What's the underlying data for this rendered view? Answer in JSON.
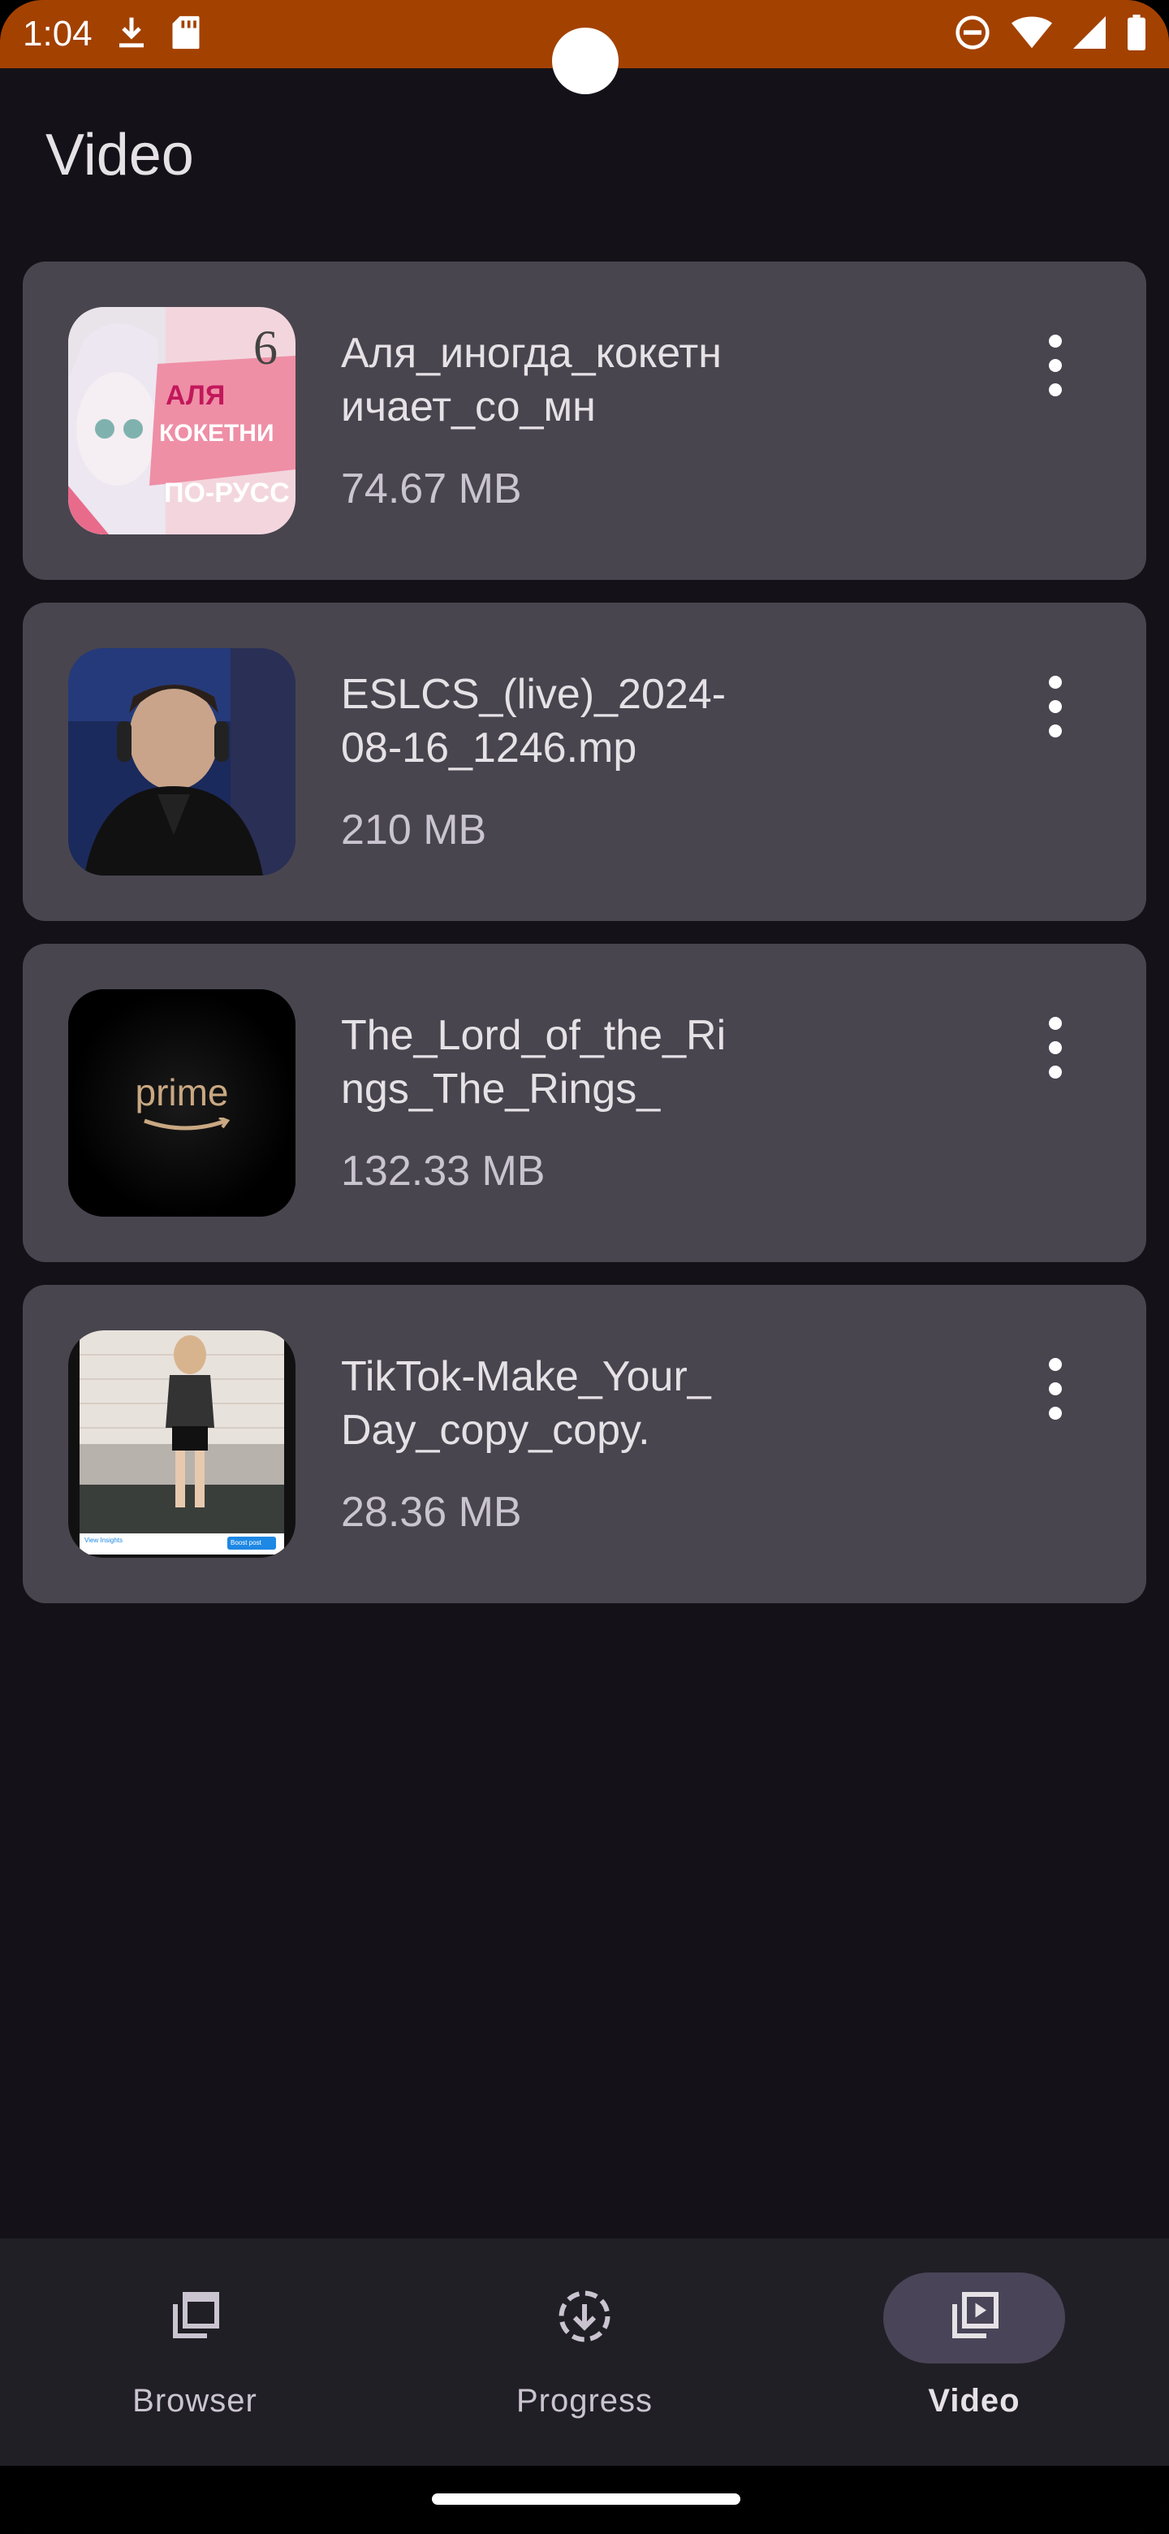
{
  "status_bar": {
    "time": "1:04",
    "left_icons": [
      "download-icon",
      "sd-card-icon"
    ],
    "right_icons": [
      "do-not-disturb-icon",
      "wifi-icon",
      "cellular-signal-icon",
      "battery-icon"
    ],
    "background": "#A34100"
  },
  "header": {
    "title": "Video"
  },
  "videos": [
    {
      "title": "Аля_иногда_кокетничает_со_мн",
      "size": "74.67 MB",
      "thumb_icon": "anime-thumbnail"
    },
    {
      "title": "ESLCS_(live)_2024-08-16_1246.mp",
      "size": "210 MB",
      "thumb_icon": "gamer-stream-thumbnail"
    },
    {
      "title": "The_Lord_of_the_Rings_The_Rings_",
      "size": "132.33 MB",
      "thumb_icon": "prime-logo-thumbnail",
      "thumb_text": "prime"
    },
    {
      "title": "TikTok-Make_Your_Day_copy_copy.",
      "size": "28.36 MB",
      "thumb_icon": "person-photo-thumbnail",
      "thumb_small_left": "View Insights",
      "thumb_small_right": "Boost post"
    }
  ],
  "bottom_nav": {
    "items": [
      {
        "label": "Browser",
        "icon": "browser-tabs-icon",
        "active": false
      },
      {
        "label": "Progress",
        "icon": "download-progress-icon",
        "active": false
      },
      {
        "label": "Video",
        "icon": "video-library-icon",
        "active": true
      }
    ]
  },
  "colors": {
    "background": "#141218",
    "card": "#49454F",
    "nav_background": "#211F26",
    "active_pill": "#4A4458"
  }
}
